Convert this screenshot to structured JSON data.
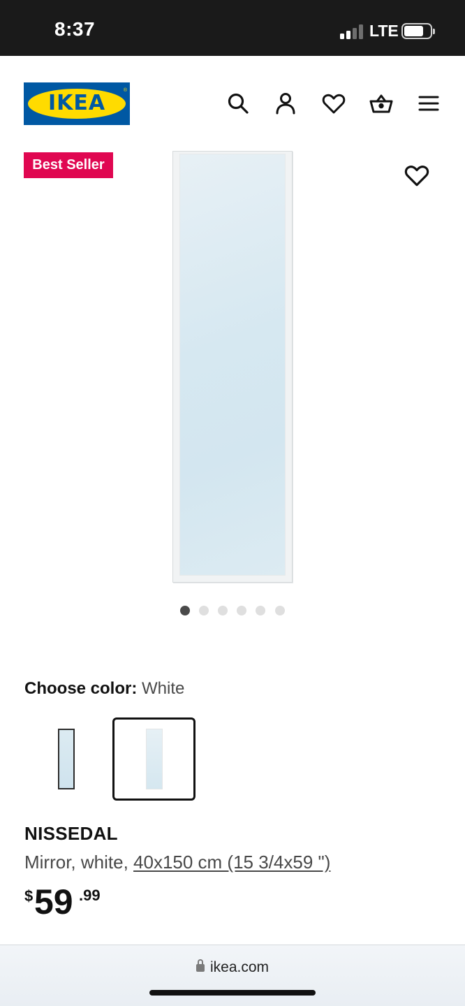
{
  "status_bar": {
    "time": "8:37",
    "network": "LTE",
    "battery_level": 0.7
  },
  "header": {
    "logo_text": "IKEA",
    "icons": [
      "search-icon",
      "account-icon",
      "wishlist-heart-icon",
      "shopping-basket-icon",
      "menu-icon"
    ]
  },
  "product_media": {
    "badge": "Best Seller",
    "image_count": 6,
    "active_image": 1
  },
  "color_chooser": {
    "label": "Choose color:",
    "selected": "White",
    "options": [
      "Black",
      "White"
    ]
  },
  "product": {
    "name": "NISSEDAL",
    "description_prefix": "Mirror, white, ",
    "dimensions": "40x150 cm (15 3/4x59 \")",
    "price": {
      "currency": "$",
      "integer": "59",
      "decimal": ".99"
    }
  },
  "browser": {
    "url": "ikea.com"
  },
  "colors": {
    "badge": "#e00751",
    "logo_blue": "#0058a3",
    "logo_yellow": "#ffdb00"
  }
}
